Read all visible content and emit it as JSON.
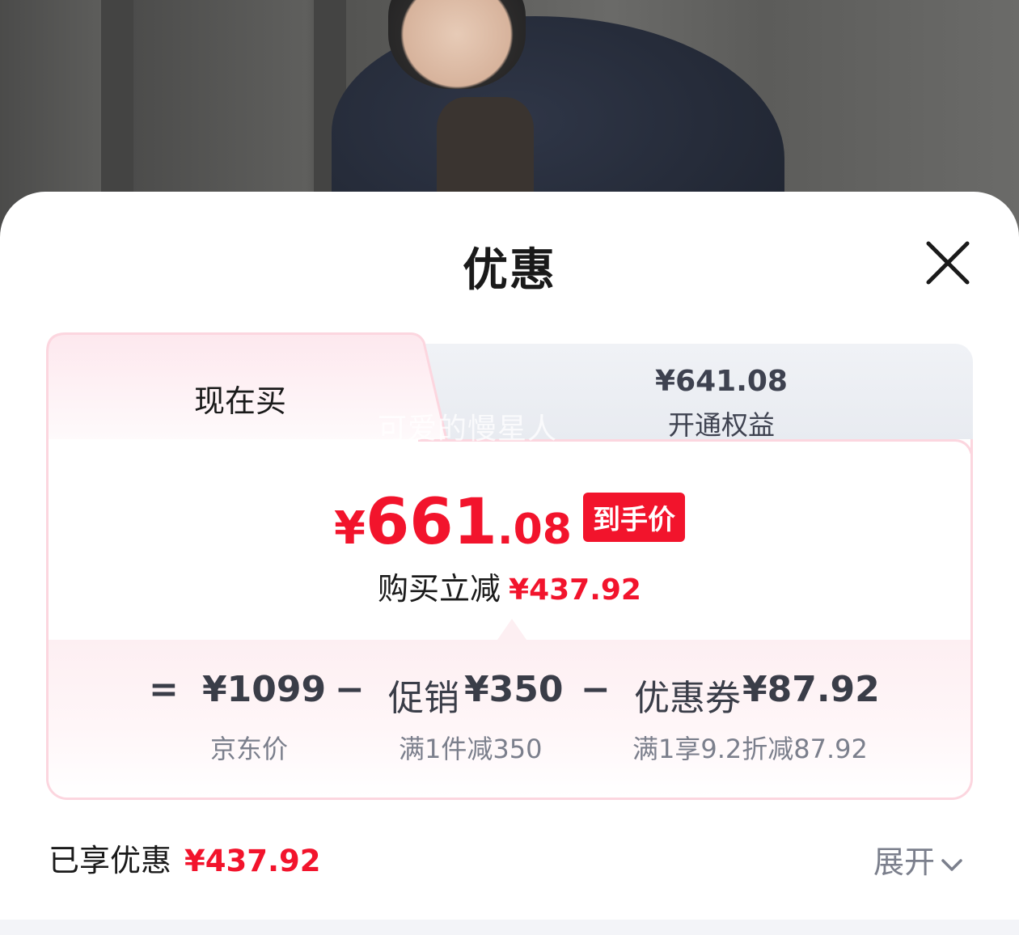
{
  "sheet": {
    "title": "优惠",
    "close_icon": "close-icon"
  },
  "tabs": {
    "current": {
      "label": "现在买"
    },
    "member": {
      "price": "¥641.08",
      "label": "开通权益"
    }
  },
  "watermark": "可爱的慢星人",
  "final_price": {
    "currency": "¥",
    "integer": "661",
    "decimal": ".08",
    "badge": "到手价"
  },
  "saving": {
    "label": "购买立减",
    "amount": "¥437.92"
  },
  "breakdown": {
    "equals": "=",
    "minus": "−",
    "jd_price": {
      "value": "¥1099",
      "caption": "京东价"
    },
    "promo": {
      "name": "促销",
      "value": "¥350",
      "caption": "满1件减350"
    },
    "coupon": {
      "name": "优惠券",
      "value": "¥87.92",
      "caption": "满1享9.2折减87.92"
    }
  },
  "enjoyed": {
    "label": "已享优惠",
    "amount": "¥437.92"
  },
  "expand": {
    "label": "展开",
    "icon": "chevron-down-icon"
  },
  "colors": {
    "accent_red": "#f2142c",
    "card_border": "#fcd6df",
    "muted_text": "#7b7f8c"
  }
}
